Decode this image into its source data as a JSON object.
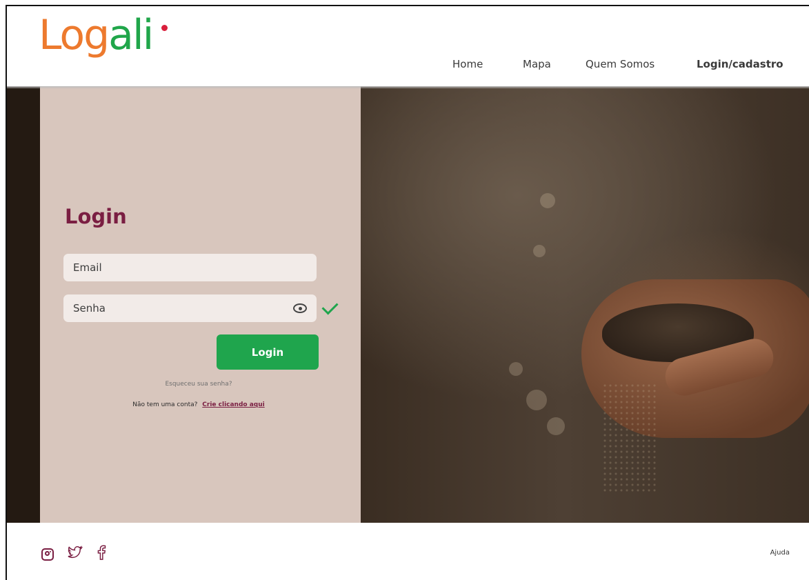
{
  "header": {
    "logo": {
      "part1": "Log",
      "part2": "ali"
    },
    "nav": {
      "home": "Home",
      "mapa": "Mapa",
      "quem_somos": "Quem Somos",
      "login_cadastro": "Login/cadastro"
    }
  },
  "login": {
    "title": "Login",
    "email_placeholder": "Email",
    "password_placeholder": "Senha",
    "submit_label": "Login",
    "forgot_password": "Esqueceu sua senha?",
    "no_account": "Não tem uma conta?",
    "create_link": "Crie clicando aqui"
  },
  "footer": {
    "help": "Ajuda",
    "social": [
      "instagram-icon",
      "twitter-icon",
      "facebook-icon"
    ]
  },
  "colors": {
    "brand_orange": "#ed7a2e",
    "brand_green": "#20a64a",
    "accent_maroon": "#7a1e42",
    "panel_bg": "#d8c6bd"
  }
}
